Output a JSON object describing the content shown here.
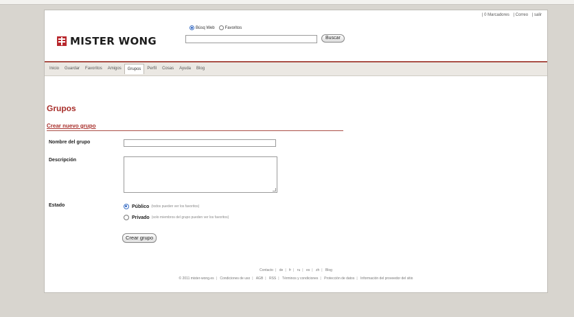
{
  "header": {
    "top_links": [
      "| 0 Marcadores",
      "| Correo",
      "| salir"
    ],
    "logo_text": "MISTER WONG",
    "search": {
      "scope_options": [
        {
          "label": "Búsq Web",
          "selected": true
        },
        {
          "label": "Favoritos",
          "selected": false
        }
      ],
      "value": "",
      "button_label": "Buscar"
    }
  },
  "nav": {
    "tabs": [
      {
        "label": "Inicio",
        "active": false
      },
      {
        "label": "Guardar",
        "active": false
      },
      {
        "label": "Favoritos",
        "active": false
      },
      {
        "label": "Amigos",
        "active": false
      },
      {
        "label": "Grupos",
        "active": true
      },
      {
        "label": "Perfil",
        "active": false
      },
      {
        "label": "Cosas",
        "active": false
      },
      {
        "label": "Ayuda",
        "active": false
      },
      {
        "label": "Blog",
        "active": false
      }
    ]
  },
  "main": {
    "title": "Grupos",
    "section_title": "Crear nuevo grupo",
    "form": {
      "name_label": "Nombre del grupo",
      "name_value": "",
      "description_label": "Descripción",
      "description_value": "",
      "status_label": "Estado",
      "status_options": [
        {
          "label": "Público",
          "hint": "(todos pueden ver los favoritos)",
          "selected": true
        },
        {
          "label": "Privado",
          "hint": "(solo miembros del grupo pueden ver los favoritos)",
          "selected": false
        }
      ],
      "submit_label": "Crear grupo"
    }
  },
  "footer": {
    "line1": [
      "Contacto",
      "de",
      "fr",
      "ru",
      "es",
      "zh",
      "Blog"
    ],
    "line2": [
      "© 2011 mister-wong.es",
      "Condiciones de uso",
      "AGB",
      "RSS",
      "Términos y condiciones",
      "Protección de datos",
      "Información del proveedor del sitio"
    ]
  },
  "colors": {
    "accent_red": "#a82f2b",
    "logo_red": "#b8282d",
    "background": "#d8d5cf"
  }
}
